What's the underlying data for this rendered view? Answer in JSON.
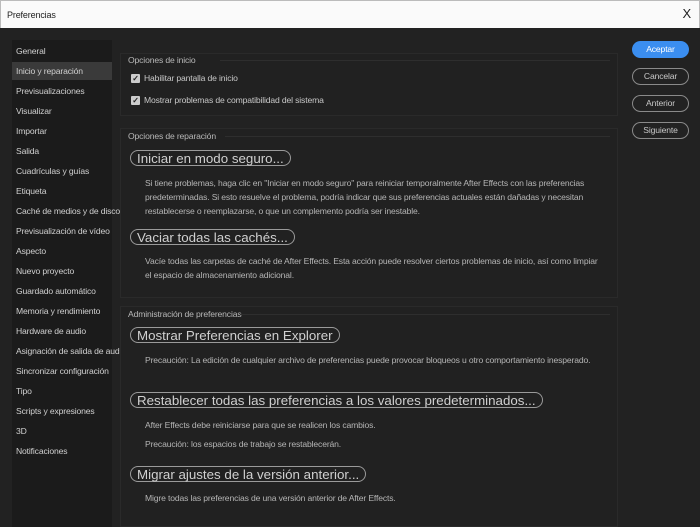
{
  "window": {
    "title": "Preferencias",
    "close": "X"
  },
  "sidebar": {
    "items": [
      "General",
      "Inicio y reparación",
      "Previsualizaciones",
      "Visualizar",
      "Importar",
      "Salida",
      "Cuadrículas y guías",
      "Etiqueta",
      "Caché de medios y de disco",
      "Previsualización de vídeo",
      "Aspecto",
      "Nuevo proyecto",
      "Guardado automático",
      "Memoria y rendimiento",
      "Hardware de audio",
      "Asignación de salida de audio",
      "Sincronizar configuración",
      "Tipo",
      "Scripts y expresiones",
      "3D",
      "Notificaciones"
    ],
    "selected": 1
  },
  "startup": {
    "heading": "Opciones de inicio",
    "checkboxes": [
      {
        "label": "Habilitar pantalla de inicio",
        "checked": true
      },
      {
        "label": "Mostrar problemas de compatibilidad del sistema",
        "checked": true
      }
    ]
  },
  "repair": {
    "heading": "Opciones de reparación",
    "safe_mode_button": "Iniciar en modo seguro...",
    "safe_mode_desc": "Si tiene problemas, haga clic en \"Iniciar en modo seguro\" para reiniciar temporalmente After Effects con las preferencias predeterminadas. Si esto resuelve el problema, podría indicar que sus preferencias actuales están dañadas y necesitan restablecerse o reemplazarse, o que un complemento podría ser inestable.",
    "clear_cache_button": "Vaciar todas las cachés...",
    "clear_cache_desc": "Vacíe todas las carpetas de caché de After Effects. Esta acción puede resolver ciertos problemas de inicio, así como limpiar el espacio de almacenamiento adicional."
  },
  "prefs": {
    "heading": "Administración de preferencias",
    "show_button": "Mostrar Preferencias en Explorer",
    "show_desc": "Precaución: La edición de cualquier archivo de preferencias puede provocar bloqueos u otro comportamiento inesperado.",
    "reset_button": "Restablecer todas las preferencias a los valores predeterminados...",
    "reset_desc1": "After Effects debe reiniciarse para que se realicen los cambios.",
    "reset_desc2": "Precaución: los espacios de trabajo se restablecerán.",
    "migrate_button": "Migrar ajustes de la versión anterior...",
    "migrate_desc": "Migre todas las preferencias de una versión anterior de After Effects."
  },
  "actions": {
    "ok": "Aceptar",
    "cancel": "Cancelar",
    "previous": "Anterior",
    "next": "Siguiente"
  },
  "colors": {
    "accent": "#3b8ef0"
  }
}
